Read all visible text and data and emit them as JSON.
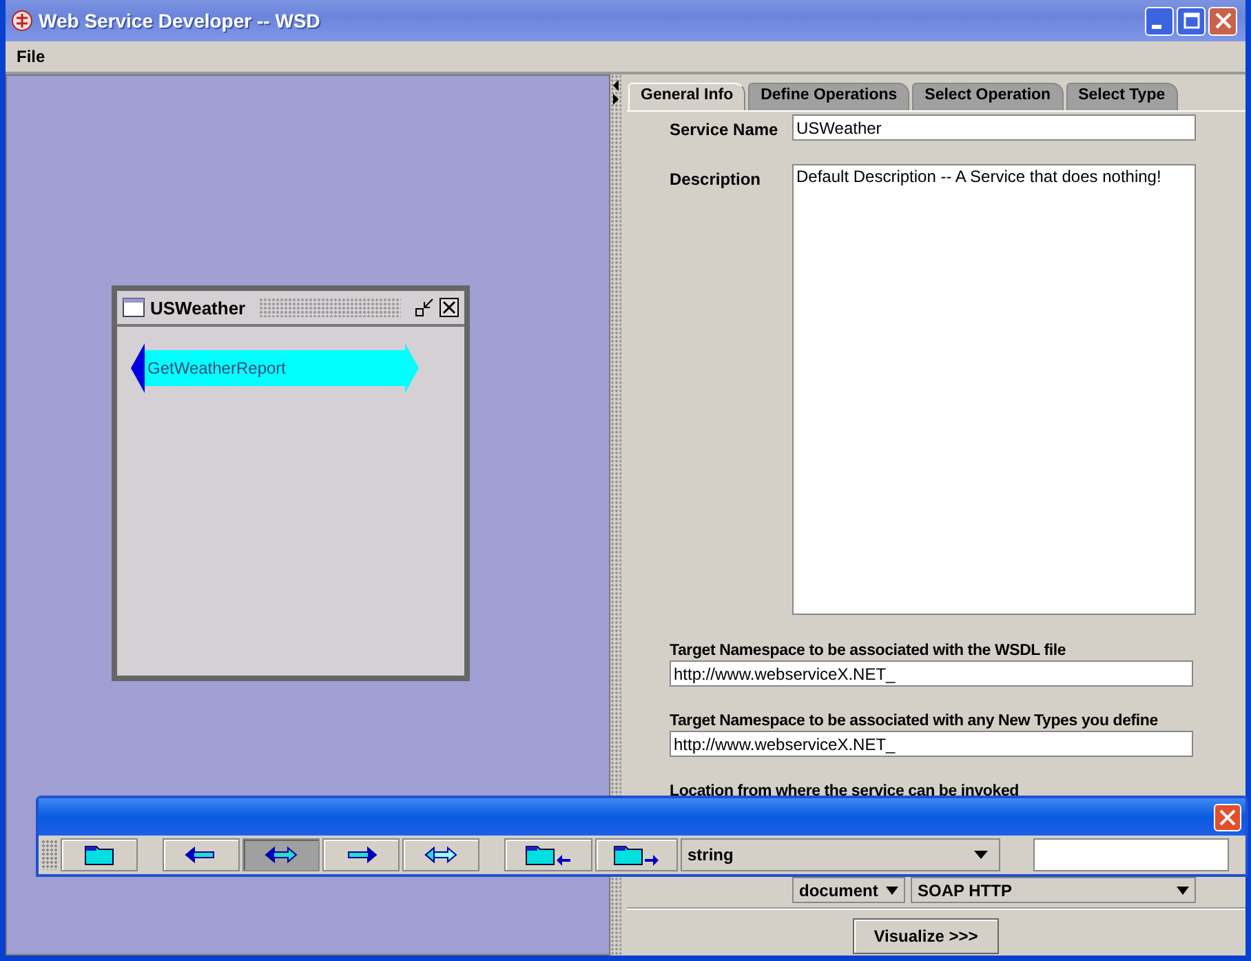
{
  "window": {
    "title": "Web Service Developer -- WSD"
  },
  "menu": [
    "File"
  ],
  "canvas": {
    "frame": {
      "title": "USWeather",
      "operations": [
        {
          "name": "GetWeatherReport"
        }
      ]
    }
  },
  "tabs": [
    {
      "label": "General Info",
      "selected": true
    },
    {
      "label": "Define Operations",
      "selected": false
    },
    {
      "label": "Select Operation",
      "selected": false
    },
    {
      "label": "Select Type",
      "selected": false
    }
  ],
  "form": {
    "service_name": {
      "label": "Service Name",
      "value": "USWeather"
    },
    "description": {
      "label": "Description",
      "value": "Default Description -- A Service that does nothing!"
    },
    "wsdl_namespace": {
      "label": "Target Namespace to be associated with the WSDL file",
      "value": "http://www.webserviceX.NET_"
    },
    "types_namespace": {
      "label": "Target Namespace to be associated with any New Types you define",
      "value": "http://www.webserviceX.NET_"
    },
    "location": {
      "label": "Location from where the service can be invoked"
    },
    "style": "document",
    "transport": "SOAP HTTP",
    "action": "Visualize >>>"
  },
  "toolbar": {
    "buttons": [
      {
        "kind": "folder",
        "selected": false
      },
      {
        "kind": "left",
        "selected": false
      },
      {
        "kind": "both",
        "selected": true
      },
      {
        "kind": "right",
        "selected": false
      },
      {
        "kind": "both-light",
        "selected": false
      },
      {
        "kind": "folder-in",
        "selected": false
      },
      {
        "kind": "folder-out",
        "selected": false
      }
    ],
    "type": "string"
  }
}
